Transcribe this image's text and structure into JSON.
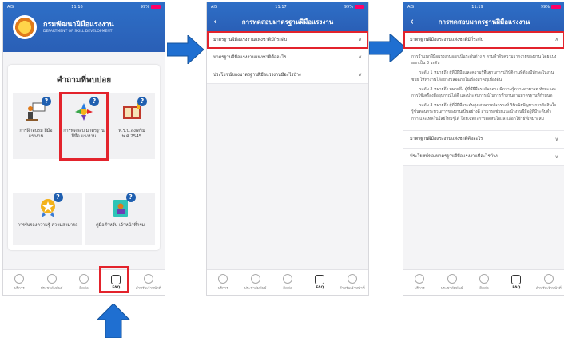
{
  "colors": {
    "brand_blue": "#2a5fb6",
    "highlight_red": "#e3232c",
    "arrow_blue": "#1f6fd1"
  },
  "phone1": {
    "status": {
      "carrier": "AIS",
      "time": "11:16",
      "battery": "99%"
    },
    "header": {
      "org_thai": "กรมพัฒนาฝีมือแรงงาน",
      "org_en": "DEPARTMENT OF SKILL DEVELOPMENT"
    },
    "faq_title": "คำถามที่พบบ่อย",
    "tiles": [
      {
        "label": "การฝึกอบรม ฝีมือแรงงาน",
        "icon": "trainer-icon"
      },
      {
        "label": "การทดสอบ มาตรฐานฝีมือ แรงงาน",
        "icon": "skill-standard-icon"
      },
      {
        "label": "พ.ร.บ.ส่งเสริม พ.ศ.2545",
        "icon": "law-book-icon"
      }
    ],
    "tiles2": [
      {
        "label": "การรับรองความรู้ ความสามารถ",
        "icon": "certificate-icon"
      },
      {
        "label": "คู่มือสำหรับ เจ้าหน้าที่กรม",
        "icon": "manual-icon"
      }
    ]
  },
  "tabbar": [
    {
      "label": "บริการ",
      "icon": "globe-icon"
    },
    {
      "label": "ประชาสัมพันธ์",
      "icon": "megaphone-icon"
    },
    {
      "label": "ติดต่อ",
      "icon": "phone-icon"
    },
    {
      "label": "FAQ",
      "icon": "faq-icon"
    },
    {
      "label": "สำหรับเจ้าหน้าที่",
      "icon": "staff-icon"
    }
  ],
  "phone2": {
    "status": {
      "carrier": "AIS",
      "time": "11:17",
      "battery": "99%"
    },
    "title": "การทดสอบมาตรฐานฝีมือแรงงาน",
    "rows": [
      "มาตรฐานฝีมือแรงงานแห่งชาติมีกี่ระดับ",
      "มาตรฐานฝีมือแรงงานแห่งชาติคืออะไร",
      "ประโยชน์ของมาตรฐานฝีมือแรงงานมีอะไรบ้าง"
    ]
  },
  "phone3": {
    "status": {
      "carrier": "AIS",
      "time": "11:19",
      "battery": "99%"
    },
    "title": "การทดสอบมาตรฐานฝีมือแรงงาน",
    "expanded_row": "มาตรฐานฝีมือแรงงานแห่งชาติมีกี่ระดับ",
    "paragraphs": [
      "การจำแนกฝีมือแรงงานออกเป็นระดับต่าง ๆ ตามลำดับความยากง่ายของงาน โดยแบ่งออกเป็น 3 ระดับ",
      "ระดับ 1 หมายถึง ผู้ที่มีฝีมือและความรู้พื้นฐานการปฏิบัติงานที่ต้องมีทักษะในงานช่วย ให้ทำงานได้อย่างปลอดภัยในเรื่องสำคัญเบื้องต้น",
      "ระดับ 2 หมายถึง หมายถึง ผู้ที่มีฝีมือระดับกลาง มีความรู้ความสามารถ ทักษะและการใช้เครื่องมืออุปกรณ์ได้ดี และประสบการณ์ในการทำงานตามมาตรฐานที่กำหนด",
      "ระดับ 3 หมายถึง ผู้ที่มีฝีมือระดับสูง สามารถวิเคราะห์ วินิจฉัยปัญหา การตัดสินใจ รู้ขั้นตอนกระบวนการของงานเป็นอย่างดี สามารถช่วยแนะนำงานฝีมือผู้ที่มีระดับต่ำกว่า และเทคโนโลยีใหม่ๆได้ โดยเฉพาะการตัดสินใจและเลือกใช้วิธีที่เหมาะสม"
    ],
    "rows": [
      "มาตรฐานฝีมือแรงงานแห่งชาติคืออะไร",
      "ประโยชน์ของมาตรฐานฝีมือแรงงานมีอะไรบ้าง"
    ]
  }
}
